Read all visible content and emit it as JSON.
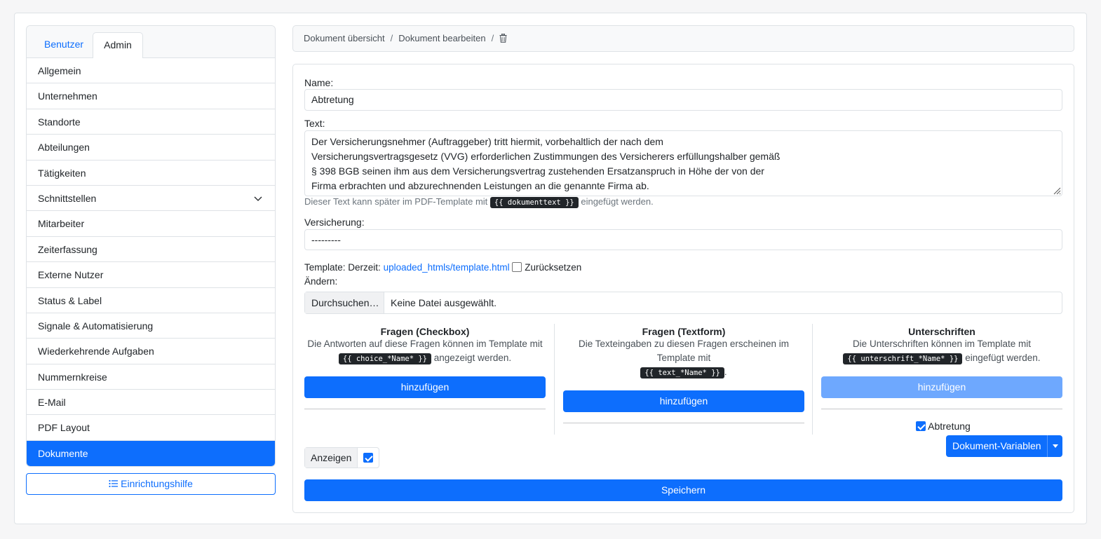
{
  "sidebar": {
    "tabs": [
      "Benutzer",
      "Admin"
    ],
    "items": [
      "Allgemein",
      "Unternehmen",
      "Standorte",
      "Abteilungen",
      "Tätigkeiten",
      "Schnittstellen",
      "Mitarbeiter",
      "Zeiterfassung",
      "Externe Nutzer",
      "Status & Label",
      "Signale & Automatisierung",
      "Wiederkehrende Aufgaben",
      "Nummernkreise",
      "E-Mail",
      "PDF Layout",
      "Dokumente"
    ],
    "active_item": "Dokumente",
    "guide_button": "Einrichtungshilfe"
  },
  "breadcrumb": {
    "items": [
      "Dokument übersicht",
      "Dokument bearbeiten"
    ],
    "separator": "/"
  },
  "form": {
    "name_label": "Name:",
    "name_value": "Abtretung",
    "text_label": "Text:",
    "text_value": "Der Versicherungsnehmer (Auftraggeber) tritt hiermit, vorbehaltlich der nach dem\nVersicherungsvertragsgesetz (VVG) erforderlichen Zustimmungen des Versicherers erfüllungshalber gemäß\n§ 398 BGB seinen ihm aus dem Versicherungsvertrag zustehenden Ersatzanspruch in Höhe der von der\nFirma erbrachten und abzurechnenden Leistungen an die genannte Firma ab.",
    "text_help_before": "Dieser Text kann später im PDF-Template mit",
    "text_help_code": "{{ dokumenttext }}",
    "text_help_after": "eingefügt werden.",
    "versicherung_label": "Versicherung:",
    "versicherung_value": "---------",
    "template_label": "Template:",
    "template_current_label": "Derzeit:",
    "template_link": "uploaded_htmls/template.html",
    "template_reset_label": "Zurücksetzen",
    "change_label": "Ändern:",
    "file_button": "Durchsuchen…",
    "file_status": "Keine Datei ausgewählt.",
    "columns": [
      {
        "title": "Fragen (Checkbox)",
        "desc_before": "Die Antworten auf diese Fragen können im Template mit",
        "code": "{{ choice_*Name* }}",
        "desc_after": "angezeigt werden.",
        "add_label": "hinzufügen"
      },
      {
        "title": "Fragen (Textform)",
        "desc_before": "Die Texteingaben zu diesen Fragen erscheinen im Template mit",
        "code": "{{ text_*Name* }}",
        "desc_after": ".",
        "add_label": "hinzufügen"
      },
      {
        "title": "Unterschriften",
        "desc_before": "Die Unterschriften können im Template mit",
        "code": "{{ unterschrift_*Name* }}",
        "desc_after": "eingefügt werden.",
        "add_label": "hinzufügen"
      }
    ],
    "signature_item": "Abtretung",
    "document_variables_button": "Dokument-Variablen",
    "anzeigen_label": "Anzeigen",
    "save_button": "Speichern"
  },
  "colors": {
    "primary": "#0d6efd",
    "primary_disabled": "#6ea8fe",
    "border": "#dee2e6",
    "code_bg": "#212529"
  },
  "icons": {
    "trash": "trash-icon",
    "list": "list-icon",
    "chevron": "chevron-down-icon"
  }
}
